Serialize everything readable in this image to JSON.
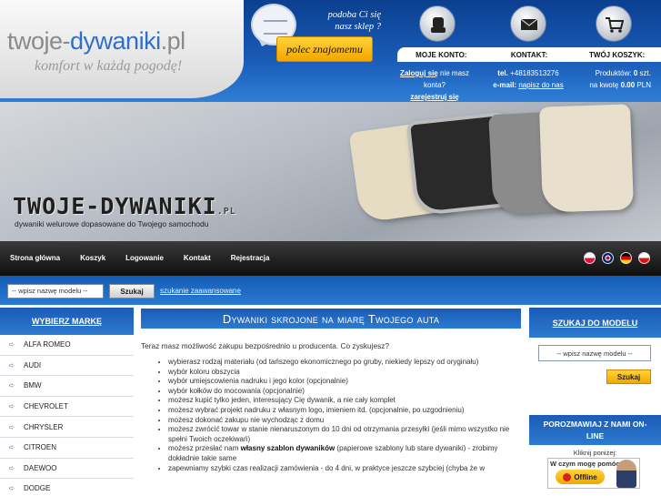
{
  "logo": {
    "part1": "twoje-",
    "part2": "dywaniki",
    "part3": ".pl",
    "tagline": "komfort w każdą pogodę!"
  },
  "recommend": {
    "text_line1": "podoba Ci się",
    "text_line2": "nasz sklep ?",
    "button": "polec znajomemu"
  },
  "header_icons": [
    "account-icon",
    "envelope-icon",
    "cart-icon"
  ],
  "info_bar": {
    "account": "MOJE KONTO:",
    "contact": "KONTAKT:",
    "cart": "TWÓJ KOSZYK:"
  },
  "account": {
    "login": "Zaloguj się",
    "no_account": "nie masz konta?",
    "register": "zarejestruj się"
  },
  "contact": {
    "tel_label": "tel.",
    "tel": "+48183513276",
    "email_label": "e-mail:",
    "email": "napisz do nas"
  },
  "cart": {
    "products_label": "Produktów:",
    "products": "0",
    "products_unit": "szt.",
    "total_label": "na kwotę",
    "total": "0.00",
    "currency": "PLN"
  },
  "banner": {
    "title": "TWOJE-DYWANIKI",
    "title_suffix": ".PL",
    "subtitle": "dywaniki welurowe dopasowane do Twojego samochodu"
  },
  "nav": {
    "items": [
      "Strona główna",
      "Koszyk",
      "Logowanie",
      "Kontakt",
      "Rejestracja"
    ]
  },
  "flags": [
    {
      "name": "flag-pl",
      "color": "#e8e8e8"
    },
    {
      "name": "flag-gb",
      "color": "#2a3f8f"
    },
    {
      "name": "flag-de",
      "color": "#c8102e"
    },
    {
      "name": "flag-cz",
      "color": "#d7141a"
    }
  ],
  "search": {
    "placeholder": "-- wpisz nazwę modelu --",
    "button": "Szukaj",
    "advanced": "szukanie zaawansowane"
  },
  "brands": {
    "heading": "WYBIERZ MARKĘ",
    "items": [
      "ALFA ROMEO",
      "AUDI",
      "BMW",
      "CHEVROLET",
      "CHRYSLER",
      "CITROEN",
      "DAEWOO",
      "DODGE"
    ]
  },
  "main": {
    "title": "Dywaniki skrojone na miarę Twojego auta",
    "intro": "Teraz masz możliwość zakupu bezpośrednio u producenta. Co zyskujesz?",
    "bullets": [
      "wybierasz rodzaj materiału (od tańszego ekonomicznego po gruby, niekiedy lepszy od oryginału)",
      "wybór koloru obszycia",
      "wybór umiejscowienia nadruku i jego kolor (opcjonalnie)",
      "wybór kołków do mocowania (opcjonalnie)",
      "możesz kupić tylko jeden, interesujący Cię dywanik, a nie cały komplet",
      "możesz wybrać projekt nadruku z własnym logo, imieniem itd. (opcjonalnie, po uzgodnieniu)",
      "możesz dokonać zakupu nie wychodząc z domu",
      "możesz zwrócić towar w stanie nienaruszonym do 10 dni od otrzymania przesyłki (jeśli mimo wszystko nie spełni Twoich oczekiwań)"
    ],
    "bullet_templates_pre": "możesz przesłać nam",
    "bullet_templates_bold": "własny szablon dywaników",
    "bullet_templates_post": "(papierowe szablony lub stare dywaniki) - zrobimy dokładnie takie same",
    "bullet_last": "zapewniamy szybki czas realizacji zamówienia - do 4 dni, w praktyce jeszcze szybciej (chyba że w"
  },
  "right": {
    "model_heading": "SZUKAJ DO MODELU",
    "model_placeholder": "-- wpisz nazwę modelu --",
    "model_button": "Szukaj",
    "chat_heading": "POROZMAWIAJ Z NAMI ON-LINE",
    "click_below": "Kliknij poniżej:",
    "help_question": "W czym mogę pomóc?",
    "offline": "Offline"
  }
}
